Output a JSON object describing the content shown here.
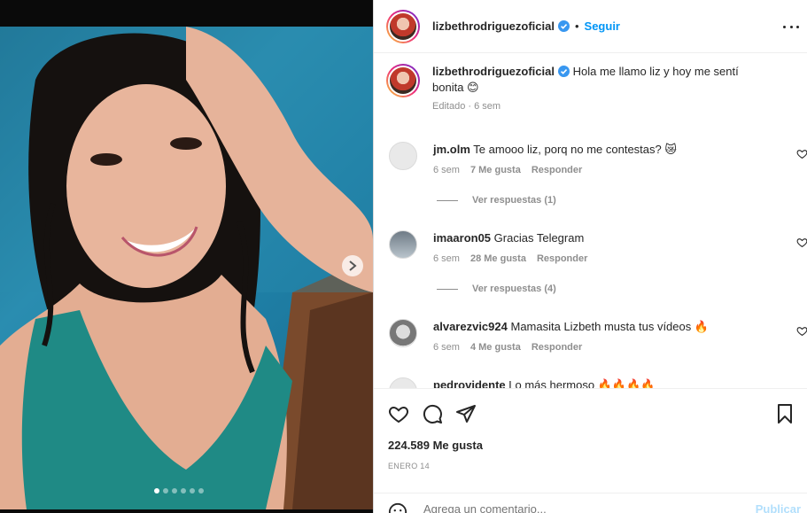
{
  "post": {
    "username": "lizbethrodriguezoficial",
    "follow_label": "Seguir",
    "separator": "•"
  },
  "caption": {
    "username": "lizbethrodriguezoficial",
    "text": "Hola me llamo liz y hoy me sentí bonita 😊",
    "meta": "Editado · 6 sem"
  },
  "comments": [
    {
      "username": "jm.olm",
      "text": "Te amooo liz, porq no me contestas? 😿",
      "time": "6 sem",
      "likes": "7 Me gusta",
      "reply": "Responder",
      "replies": "Ver respuestas (1)"
    },
    {
      "username": "imaaron05",
      "text": "Gracias Telegram",
      "time": "6 sem",
      "likes": "28 Me gusta",
      "reply": "Responder",
      "replies": "Ver respuestas (4)"
    },
    {
      "username": "alvarezvic924",
      "text": "Mamasita Lizbeth musta tus vídeos 🔥",
      "time": "6 sem",
      "likes": "4 Me gusta",
      "reply": "Responder"
    },
    {
      "username": "pedrovidente",
      "text": "Lo más hermoso 🔥🔥🔥🔥"
    }
  ],
  "engagement": {
    "likes": "224.589 Me gusta",
    "date": "ENERO 14"
  },
  "composer": {
    "placeholder": "Agrega un comentario...",
    "publish_label": "Publicar"
  },
  "carousel": {
    "dot_count": 6,
    "active_index": 0
  },
  "colors": {
    "accent": "#0095f6",
    "muted": "#8e8e8e",
    "verified": "#3897f0"
  },
  "icons": [
    "more-options-icon",
    "verified-badge-icon",
    "heart-icon",
    "comment-icon",
    "share-icon",
    "bookmark-icon",
    "emoji-icon",
    "next-arrow-icon"
  ]
}
